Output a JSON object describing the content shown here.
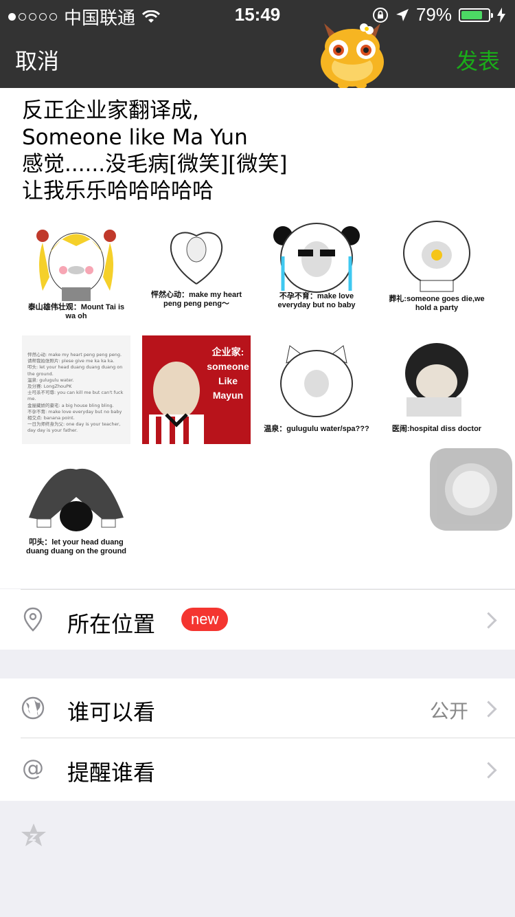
{
  "status_bar": {
    "carrier": "中国联通",
    "time": "15:49",
    "battery": "79%",
    "battery_level": 0.79
  },
  "nav": {
    "cancel": "取消",
    "post": "发表"
  },
  "post_lines": [
    "反正企业家翻译成,",
    "Someone like Ma Yun",
    "感觉......没毛病[微笑][微笑]",
    "让我乐乐哈哈哈哈哈"
  ],
  "images": [
    {
      "caption": "泰山雄伟壮观：Mount Tai is wa oh"
    },
    {
      "caption": "怦然心动：make my heart peng peng peng～"
    },
    {
      "caption": "不孕不育：make love everyday but no baby"
    },
    {
      "caption": "葬礼:someone goes die,we hold a party"
    },
    {
      "text_lines": [
        "怦然心动: make my heart peng peng peng.",
        "请帮我拍张照片: plese give me ka ka ka.",
        "叩头: let your head duang duang duang on the ground.",
        "温泉: gulugulu water.",
        "及分赛: LongZhouPK",
        "士可杀不可辱: you can kill me but can't fuck me.",
        "金屋藏娇的豪宅: a big house bling bling.",
        "不孕不育: make love everyday but no baby",
        "相交点: banana point.",
        "一日为师终身为父: one day is your teacher, day day is your father."
      ]
    },
    {
      "overlay": [
        "企业家:",
        "someone",
        "Like",
        "Mayun"
      ]
    },
    {
      "caption": "温泉：gulugulu water/spa???"
    },
    {
      "caption": "医闹:hospital diss doctor"
    },
    {
      "caption": "叩头：let your head duang duang duang on the ground"
    }
  ],
  "rows": {
    "location": {
      "label": "所在位置",
      "badge": "new"
    },
    "visibility": {
      "label": "谁可以看",
      "value": "公开"
    },
    "remind": {
      "label": "提醒谁看",
      "icon_text": "@"
    }
  }
}
